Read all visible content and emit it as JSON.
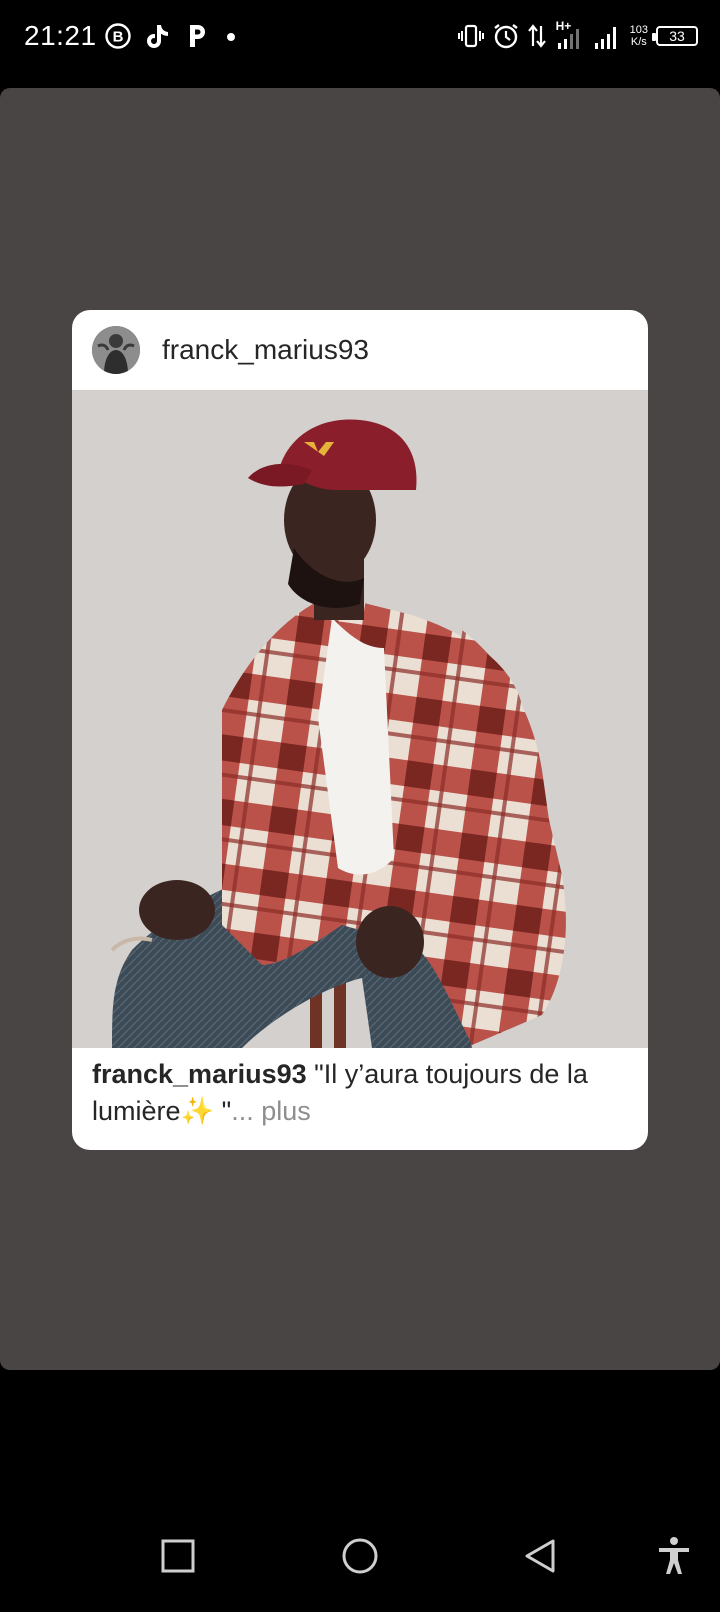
{
  "status_bar": {
    "time": "21:21",
    "left_icons": [
      "business-chat-icon",
      "tiktok-icon",
      "p-app-icon",
      "notification-dot-icon"
    ],
    "right_icons": [
      "vibrate-icon",
      "alarm-icon",
      "data-arrows-icon",
      "signal-h-plus-icon",
      "signal-icon"
    ],
    "network_type": "H+",
    "speed_value": "103",
    "speed_unit": "K/s",
    "battery": "33"
  },
  "post": {
    "username": "franck_marius93",
    "caption_user": "franck_marius93",
    "caption_text": " \"Il y’aura toujours de la lumière✨ \"",
    "caption_ellipsis": "...",
    "caption_more": " plus",
    "avatar_icon": "profile-avatar",
    "photo_icon": "post-photo"
  },
  "nav_bar": {
    "recents_icon": "square-icon",
    "home_icon": "circle-icon",
    "back_icon": "triangle-back-icon",
    "accessibility_icon": "accessibility-icon"
  },
  "colors": {
    "story_background": "#4a4545",
    "card_background": "#ffffff",
    "caption_text": "#262626",
    "more_text": "#8e8e8e",
    "cap_red": "#8b1e2b"
  }
}
